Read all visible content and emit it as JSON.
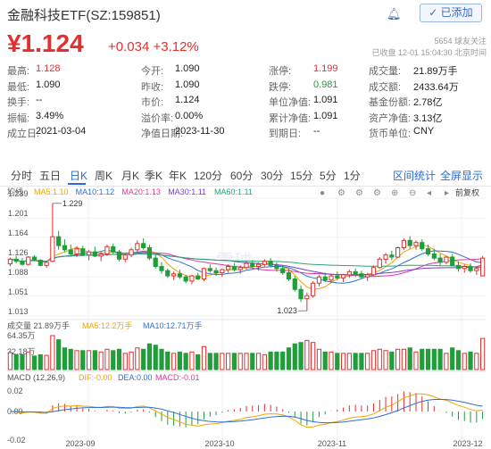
{
  "header": {
    "title": "金融科技ETF(SZ:159851)",
    "bell_icon": "bell-icon",
    "add_button": "✓ 已添加",
    "price": "¥1.124",
    "change": "+0.034  +3.12%",
    "followers": "5654 球友关注",
    "status": "已收盘 12-01 15:04:30 北京时间"
  },
  "stats": [
    [
      {
        "label": "最高:",
        "value": "1.128",
        "color": "red"
      },
      {
        "label": "今开:",
        "value": "1.090",
        "color": "v"
      },
      {
        "label": "涨停:",
        "value": "1.199",
        "color": "red"
      },
      {
        "label": "成交量:",
        "value": "21.89万手",
        "color": "v"
      }
    ],
    [
      {
        "label": "最低:",
        "value": "1.090",
        "color": "v"
      },
      {
        "label": "昨收:",
        "value": "1.090",
        "color": "v"
      },
      {
        "label": "跌停:",
        "value": "0.981",
        "color": "grn"
      },
      {
        "label": "成交额:",
        "value": "2433.64万",
        "color": "v"
      }
    ],
    [
      {
        "label": "换手:",
        "value": "--",
        "color": "v"
      },
      {
        "label": "市价:",
        "value": "1.124",
        "color": "v"
      },
      {
        "label": "单位净值:",
        "value": "1.091",
        "color": "v"
      },
      {
        "label": "基金份额:",
        "value": "2.78亿",
        "color": "v"
      }
    ],
    [
      {
        "label": "振幅:",
        "value": "3.49%",
        "color": "v"
      },
      {
        "label": "溢价率:",
        "value": "0.00%",
        "color": "v"
      },
      {
        "label": "累计净值:",
        "value": "1.091",
        "color": "v"
      },
      {
        "label": "资产净值:",
        "value": "3.13亿",
        "color": "v"
      }
    ],
    [
      {
        "label": "成立日:",
        "value": "2021-03-04",
        "color": "v"
      },
      {
        "label": "净值日期:",
        "value": "2023-11-30",
        "color": "v"
      },
      {
        "label": "到期日:",
        "value": "--",
        "color": "v"
      },
      {
        "label": "货币单位:",
        "value": "CNY",
        "color": "v"
      }
    ]
  ],
  "tabs": [
    "分时",
    "五日",
    "日K",
    "周K",
    "月K",
    "季K",
    "年K",
    "120分",
    "60分",
    "30分",
    "15分",
    "5分",
    "1分"
  ],
  "active_tab": "日K",
  "right_links": {
    "interval": "区间统计",
    "fullscreen": "全屏显示"
  },
  "toolbar": {
    "label": "均线",
    "ma": [
      {
        "text": "MA5:1.10",
        "color": "#f0a500"
      },
      {
        "text": "MA10:1.12",
        "color": "#2f6fd6"
      },
      {
        "text": "MA20:1.13",
        "color": "#e0389a"
      },
      {
        "text": "MA30:1.11",
        "color": "#7a3fd1"
      },
      {
        "text": "MA60:1.11",
        "color": "#2aa572"
      }
    ],
    "icons": [
      "dot-icon",
      "settings-icon",
      "settings-icon",
      "settings-icon",
      "zoom-in-icon",
      "zoom-out-icon",
      "arrow-left-icon",
      "arrow-right-icon",
      "chart-icon"
    ],
    "rights": "前复权"
  },
  "chart_data": {
    "type": "candlestick",
    "y_ticks": [
      "1.239",
      "1.201",
      "1.164",
      "1.126",
      "1.088",
      "1.051",
      "1.013"
    ],
    "ylim": [
      1.013,
      1.239
    ],
    "annotations": {
      "high": "1.229",
      "low": "1.023"
    },
    "x_labels": [
      "2023-09",
      "2023-10",
      "2023-11",
      "2023-12"
    ],
    "watermark": "雪球",
    "candles": [
      [
        1.113,
        1.125,
        1.108,
        1.122
      ],
      [
        1.122,
        1.128,
        1.114,
        1.118
      ],
      [
        1.118,
        1.124,
        1.11,
        1.112
      ],
      [
        1.112,
        1.128,
        1.11,
        1.126
      ],
      [
        1.126,
        1.13,
        1.118,
        1.12
      ],
      [
        1.12,
        1.122,
        1.108,
        1.11
      ],
      [
        1.11,
        1.118,
        1.105,
        1.116
      ],
      [
        1.118,
        1.229,
        1.116,
        1.165
      ],
      [
        1.165,
        1.176,
        1.14,
        1.148
      ],
      [
        1.148,
        1.16,
        1.136,
        1.14
      ],
      [
        1.14,
        1.15,
        1.128,
        1.132
      ],
      [
        1.132,
        1.146,
        1.126,
        1.142
      ],
      [
        1.142,
        1.148,
        1.128,
        1.13
      ],
      [
        1.13,
        1.14,
        1.12,
        1.136
      ],
      [
        1.136,
        1.146,
        1.126,
        1.128
      ],
      [
        1.128,
        1.136,
        1.118,
        1.132
      ],
      [
        1.132,
        1.15,
        1.128,
        1.146
      ],
      [
        1.146,
        1.152,
        1.132,
        1.136
      ],
      [
        1.136,
        1.14,
        1.118,
        1.122
      ],
      [
        1.122,
        1.132,
        1.116,
        1.13
      ],
      [
        1.13,
        1.144,
        1.126,
        1.14
      ],
      [
        1.14,
        1.158,
        1.134,
        1.152
      ],
      [
        1.152,
        1.162,
        1.14,
        1.144
      ],
      [
        1.144,
        1.15,
        1.12,
        1.124
      ],
      [
        1.124,
        1.132,
        1.104,
        1.108
      ],
      [
        1.108,
        1.116,
        1.094,
        1.1
      ],
      [
        1.1,
        1.104,
        1.086,
        1.09
      ],
      [
        1.09,
        1.098,
        1.082,
        1.094
      ],
      [
        1.094,
        1.102,
        1.084,
        1.088
      ],
      [
        1.088,
        1.092,
        1.076,
        1.08
      ],
      [
        1.08,
        1.092,
        1.074,
        1.09
      ],
      [
        1.09,
        1.096,
        1.082,
        1.084
      ],
      [
        1.084,
        1.106,
        1.08,
        1.104
      ],
      [
        1.104,
        1.112,
        1.096,
        1.1
      ],
      [
        1.1,
        1.106,
        1.09,
        1.096
      ],
      [
        1.096,
        1.104,
        1.088,
        1.102
      ],
      [
        1.102,
        1.112,
        1.096,
        1.108
      ],
      [
        1.108,
        1.114,
        1.098,
        1.102
      ],
      [
        1.102,
        1.11,
        1.094,
        1.106
      ],
      [
        1.106,
        1.118,
        1.102,
        1.114
      ],
      [
        1.114,
        1.12,
        1.104,
        1.108
      ],
      [
        1.108,
        1.116,
        1.1,
        1.112
      ],
      [
        1.112,
        1.122,
        1.108,
        1.118
      ],
      [
        1.118,
        1.124,
        1.106,
        1.11
      ],
      [
        1.11,
        1.116,
        1.098,
        1.104
      ],
      [
        1.104,
        1.11,
        1.092,
        1.096
      ],
      [
        1.096,
        1.104,
        1.08,
        1.084
      ],
      [
        1.084,
        1.09,
        1.06,
        1.064
      ],
      [
        1.064,
        1.072,
        1.04,
        1.046
      ],
      [
        1.046,
        1.058,
        1.023,
        1.052
      ],
      [
        1.052,
        1.08,
        1.048,
        1.076
      ],
      [
        1.076,
        1.092,
        1.07,
        1.088
      ],
      [
        1.088,
        1.096,
        1.078,
        1.082
      ],
      [
        1.082,
        1.094,
        1.076,
        1.09
      ],
      [
        1.09,
        1.098,
        1.082,
        1.086
      ],
      [
        1.086,
        1.094,
        1.078,
        1.092
      ],
      [
        1.092,
        1.102,
        1.086,
        1.098
      ],
      [
        1.098,
        1.104,
        1.088,
        1.094
      ],
      [
        1.094,
        1.1,
        1.084,
        1.088
      ],
      [
        1.088,
        1.096,
        1.08,
        1.092
      ],
      [
        1.092,
        1.11,
        1.09,
        1.106
      ],
      [
        1.106,
        1.126,
        1.104,
        1.122
      ],
      [
        1.122,
        1.134,
        1.114,
        1.13
      ],
      [
        1.13,
        1.138,
        1.12,
        1.126
      ],
      [
        1.126,
        1.146,
        1.124,
        1.144
      ],
      [
        1.144,
        1.162,
        1.14,
        1.158
      ],
      [
        1.158,
        1.166,
        1.142,
        1.148
      ],
      [
        1.148,
        1.158,
        1.14,
        1.154
      ],
      [
        1.154,
        1.16,
        1.138,
        1.142
      ],
      [
        1.142,
        1.15,
        1.128,
        1.132
      ],
      [
        1.132,
        1.142,
        1.12,
        1.124
      ],
      [
        1.124,
        1.132,
        1.11,
        1.116
      ],
      [
        1.116,
        1.128,
        1.112,
        1.126
      ],
      [
        1.126,
        1.132,
        1.108,
        1.11
      ],
      [
        1.11,
        1.118,
        1.098,
        1.104
      ],
      [
        1.104,
        1.112,
        1.096,
        1.108
      ],
      [
        1.108,
        1.114,
        1.096,
        1.1
      ],
      [
        1.1,
        1.108,
        1.092,
        1.104
      ],
      [
        1.09,
        1.128,
        1.09,
        1.124
      ]
    ],
    "volume": {
      "legend": "成交量 21.89万手",
      "ma5": "MA5:12.2万手",
      "ma10": "MA10:12.71万手",
      "y_ticks": [
        "64.35万",
        "32.18万"
      ]
    },
    "macd": {
      "legend": "MACD (12,26,9)",
      "dif": "DIF:-0.00",
      "dea": "DEA:0.00",
      "macd": "MACD:-0.01",
      "y_ticks": [
        "0.02",
        "0.00",
        "-0.02"
      ]
    }
  }
}
